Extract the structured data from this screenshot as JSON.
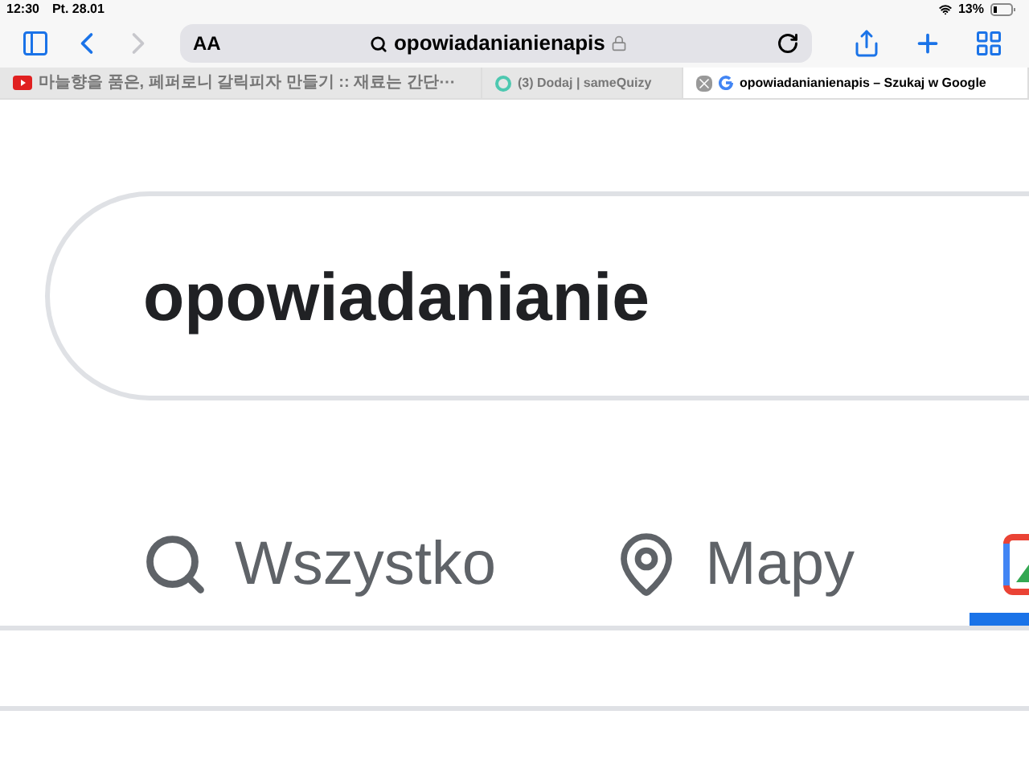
{
  "status_bar": {
    "time": "12:30",
    "date": "Pt. 28.01",
    "battery": "13%"
  },
  "toolbar": {
    "text_size": "AA",
    "address": "opowiadanianienapis"
  },
  "tabs": [
    {
      "title": "마늘향을 품은, 페퍼로니 갈릭피자 만들기 :: 재료는 간단⋯",
      "selected": false,
      "kind": "video"
    },
    {
      "title": "(3) Dodaj | sameQuizy",
      "selected": false,
      "kind": "quiz"
    },
    {
      "title": "opowiadanianienapis – Szukaj w Google",
      "selected": true,
      "kind": "google"
    }
  ],
  "search": {
    "value": "opowiadanianie"
  },
  "nav": [
    {
      "label": "Wszystko",
      "kind": "search",
      "selected": false
    },
    {
      "label": "Mapy",
      "kind": "pin",
      "selected": false
    },
    {
      "kind": "images",
      "selected": true
    }
  ]
}
